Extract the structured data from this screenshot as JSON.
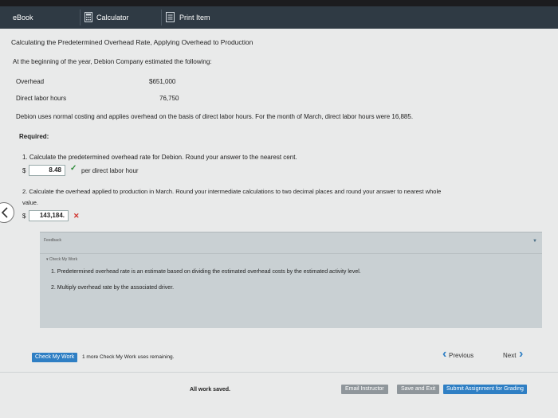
{
  "tabs": [
    {
      "label": "eBook",
      "icon": "none"
    },
    {
      "label": "Calculator",
      "icon": "calculator-icon"
    },
    {
      "label": "Print Item",
      "icon": "print-icon"
    }
  ],
  "problem": {
    "title": "Calculating the Predetermined Overhead Rate, Applying Overhead to Production",
    "intro": "At the beginning of the year, Debion Company estimated the following:",
    "estimates": [
      {
        "label": "Overhead",
        "value": "$651,000"
      },
      {
        "label": "Direct labor hours",
        "value": "76,750"
      }
    ],
    "description": "Debion uses normal costing and applies overhead on the basis of direct labor hours. For the month of March, direct labor hours were 16,885.",
    "required_label": "Required:"
  },
  "questions": [
    {
      "text": "1. Calculate the predetermined overhead rate for Debion. Round your answer to the nearest cent.",
      "currency": "$",
      "answer": "8.48",
      "unit": "per direct labor hour",
      "status": "correct",
      "status_symbol": "✓"
    },
    {
      "text": "2. Calculate the overhead applied to production in March. Round your intermediate calculations to two decimal places and round your answer to nearest whole",
      "text_cont": "value.",
      "currency": "$",
      "answer": "143,184.",
      "status": "incorrect",
      "status_symbol": "✕"
    }
  ],
  "feedback": {
    "header": "Feedback",
    "toggle_label": "▾ Check My Work",
    "items": [
      "1. Predetermined overhead rate is an estimate based on dividing the estimated overhead costs by the estimated activity level.",
      "2. Multiply overhead rate by the associated driver."
    ],
    "caret": "▼"
  },
  "footer": {
    "check_button": "Check My Work",
    "remaining_text": "1 more Check My Work uses remaining.",
    "previous": "Previous",
    "next": "Next",
    "saved_status": "All work saved.",
    "email_button": "Email Instructor",
    "save_exit_button": "Save and Exit",
    "submit_button": "Submit Assignment for Grading"
  },
  "colors": {
    "accent": "#2f7fc4",
    "correct": "#2e8b3a",
    "incorrect": "#d0302a",
    "tabbar": "#2f3a44"
  }
}
